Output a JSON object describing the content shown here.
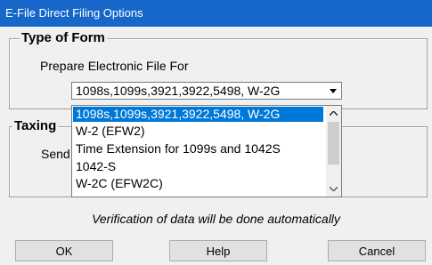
{
  "window": {
    "title": "E-File Direct Filing Options"
  },
  "type_of_form": {
    "legend": "Type of Form",
    "label": "Prepare Electronic File For",
    "selected": "1098s,1099s,3921,3922,5498, W-2G"
  },
  "dropdown": {
    "options": [
      "1098s,1099s,3921,3922,5498, W-2G",
      "W-2 (EFW2)",
      "Time Extension for 1099s and 1042S",
      "1042-S",
      "W-2C (EFW2C)"
    ]
  },
  "taxing": {
    "legend_visible": "Taxing",
    "label_visible": "Send"
  },
  "note": "Verification of data will be done automatically",
  "buttons": {
    "ok": "OK",
    "help": "Help",
    "cancel": "Cancel"
  },
  "icons": {
    "combo_arrow": "chevron-down-icon",
    "scroll_up": "scroll-up-icon",
    "scroll_down": "scroll-down-icon"
  }
}
